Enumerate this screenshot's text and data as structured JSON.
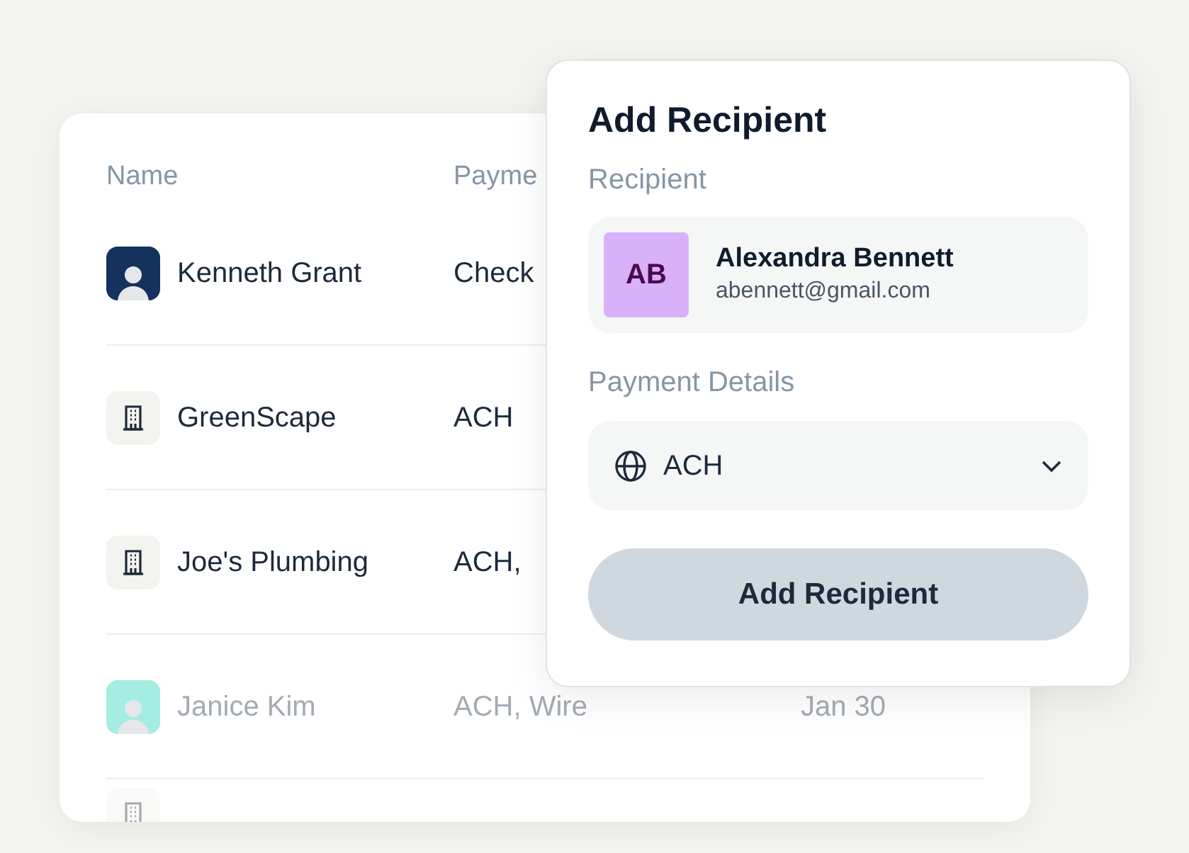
{
  "table": {
    "columns": [
      "Name",
      "Payme"
    ],
    "rows": [
      {
        "name": "Kenneth Grant",
        "payment": "Check",
        "kind": "person",
        "color": "#15315e",
        "faded": false
      },
      {
        "name": "GreenScape",
        "payment": "ACH",
        "kind": "company",
        "faded": false
      },
      {
        "name": "Joe's Plumbing",
        "payment": "ACH,",
        "kind": "company",
        "faded": false
      },
      {
        "name": "Janice Kim",
        "payment": "ACH, Wire",
        "date": "Jan 30",
        "kind": "person",
        "color": "#a5ece3",
        "faded": true
      },
      {
        "kind": "company",
        "faded": true
      }
    ]
  },
  "dialog": {
    "title": "Add Recipient",
    "recipient_label": "Recipient",
    "recipient": {
      "initials": "AB",
      "name": "Alexandra Bennett",
      "email": "abennett@gmail.com"
    },
    "payment_label": "Payment Details",
    "payment_select": {
      "value": "ACH"
    },
    "submit_button": {
      "label": "Add Recipient",
      "disabled": true
    }
  }
}
